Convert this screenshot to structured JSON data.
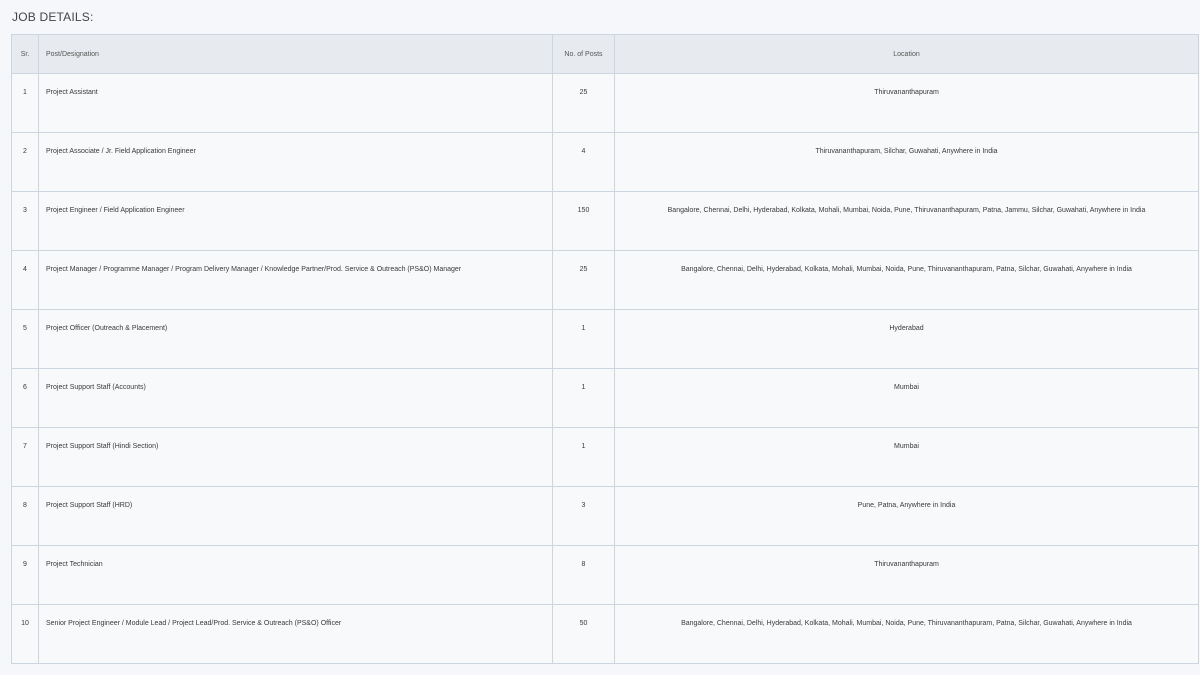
{
  "section_title": "JOB DETAILS:",
  "table": {
    "headers": {
      "sr": "Sr.",
      "post": "Post/Designation",
      "num": "No. of Posts",
      "location": "Location"
    },
    "rows": [
      {
        "sr": "1",
        "post": "Project Assistant",
        "num": "25",
        "location": "Thiruvananthapuram"
      },
      {
        "sr": "2",
        "post": "Project Associate / Jr. Field Application Engineer",
        "num": "4",
        "location": "Thiruvananthapuram, Silchar, Guwahati, Anywhere in India"
      },
      {
        "sr": "3",
        "post": "Project Engineer / Field Application Engineer",
        "num": "150",
        "location": "Bangalore, Chennai, Delhi, Hyderabad, Kolkata, Mohali, Mumbai, Noida, Pune, Thiruvananthapuram, Patna, Jammu, Silchar, Guwahati, Anywhere in India"
      },
      {
        "sr": "4",
        "post": "Project Manager / Programme Manager / Program Delivery Manager / Knowledge Partner/Prod. Service & Outreach (PS&O) Manager",
        "num": "25",
        "location": "Bangalore, Chennai, Delhi, Hyderabad, Kolkata, Mohali, Mumbai, Noida, Pune, Thiruvananthapuram, Patna, Silchar, Guwahati, Anywhere in India"
      },
      {
        "sr": "5",
        "post": "Project Officer (Outreach & Placement)",
        "num": "1",
        "location": "Hyderabad"
      },
      {
        "sr": "6",
        "post": "Project Support Staff (Accounts)",
        "num": "1",
        "location": "Mumbai"
      },
      {
        "sr": "7",
        "post": "Project Support Staff (Hindi Section)",
        "num": "1",
        "location": "Mumbai"
      },
      {
        "sr": "8",
        "post": "Project Support Staff (HRD)",
        "num": "3",
        "location": "Pune, Patna, Anywhere in India"
      },
      {
        "sr": "9",
        "post": "Project Technician",
        "num": "8",
        "location": "Thiruvananthapuram"
      },
      {
        "sr": "10",
        "post": "Senior Project Engineer / Module Lead / Project Lead/Prod. Service & Outreach (PS&O) Officer",
        "num": "50",
        "location": "Bangalore, Chennai, Delhi, Hyderabad, Kolkata, Mohali, Mumbai, Noida, Pune, Thiruvananthapuram, Patna, Silchar, Guwahati, Anywhere in India"
      }
    ]
  }
}
